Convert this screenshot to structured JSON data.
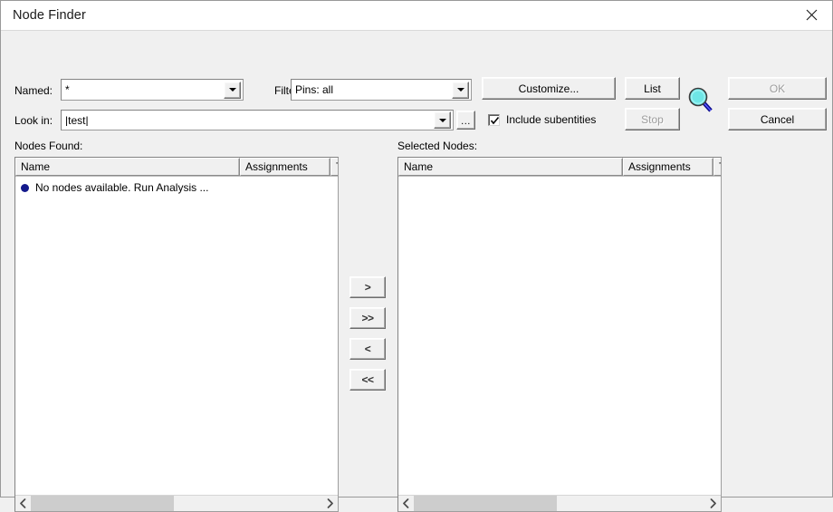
{
  "window": {
    "title": "Node Finder",
    "close_icon": "close-icon"
  },
  "form": {
    "named_label": "Named:",
    "named_value": "*",
    "filter_label": "Filter:",
    "filter_value": "Pins: all",
    "lookin_label": "Look in:",
    "lookin_value": "|test|",
    "browse_label": "...",
    "include_subentities_label": "Include subentities",
    "include_subentities_checked": true
  },
  "actions": {
    "customize_label": "Customize...",
    "list_label": "List",
    "stop_label": "Stop",
    "ok_label": "OK",
    "cancel_label": "Cancel",
    "search_icon": "magnifier-icon"
  },
  "transfer": {
    "add_label": ">",
    "add_all_label": ">>",
    "remove_label": "<",
    "remove_all_label": "<<"
  },
  "nodes_found": {
    "caption": "Nodes Found:",
    "columns": [
      "Name",
      "Assignments",
      "T"
    ],
    "rows": [
      {
        "icon": "node-bullet-icon",
        "name": "No nodes available.  Run Analysis ..."
      }
    ],
    "scroll": {
      "left_arrow": "‹",
      "right_arrow": "›"
    }
  },
  "selected_nodes": {
    "caption": "Selected Nodes:",
    "columns": [
      "Name",
      "Assignments",
      "T"
    ],
    "rows": [],
    "scroll": {
      "left_arrow": "‹",
      "right_arrow": "›"
    }
  },
  "colors": {
    "dialog_bg": "#f0f0f0",
    "titlebar_bg": "#ffffff",
    "field_bg": "#ffffff",
    "bullet": "#141a8c",
    "magnifier_lens": "#6ee6e6",
    "magnifier_handle": "#2b2bd4",
    "disabled_text": "#9c9c9c",
    "scroll_thumb": "#cdcdcd"
  }
}
